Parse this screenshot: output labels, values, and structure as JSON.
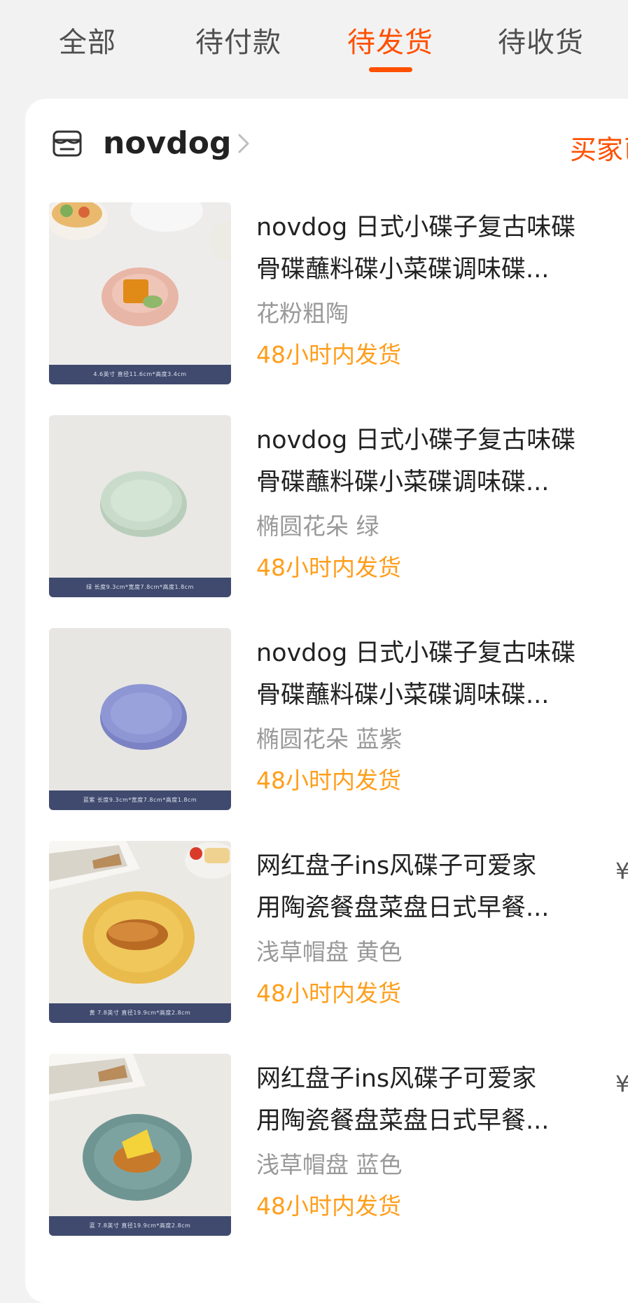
{
  "tabs": [
    {
      "label": "全部",
      "active": false
    },
    {
      "label": "待付款",
      "active": false
    },
    {
      "label": "待发货",
      "active": true
    },
    {
      "label": "待收货",
      "active": false
    }
  ],
  "order": {
    "store_icon": "store-icon",
    "store_name": "novdog",
    "status_text": "买家已",
    "items": [
      {
        "title_line1": "novdog 日式小碟子复古味碟",
        "title_line2": "骨碟蘸料碟小菜碟调味碟...",
        "spec": "花粉粗陶",
        "shipping": "48小时内发货",
        "price": "",
        "thumb_caption": "4.6英寸 直径11.6cm*高度3.4cm",
        "dish_color": "#e8b6a6"
      },
      {
        "title_line1": "novdog 日式小碟子复古味碟",
        "title_line2": "骨碟蘸料碟小菜碟调味碟...",
        "spec": "椭圆花朵 绿",
        "shipping": "48小时内发货",
        "price": "",
        "thumb_caption": "绿 长度9.3cm*宽度7.8cm*高度1.8cm",
        "dish_color": "#c9dccb"
      },
      {
        "title_line1": "novdog 日式小碟子复古味碟",
        "title_line2": "骨碟蘸料碟小菜碟调味碟...",
        "spec": "椭圆花朵 蓝紫",
        "shipping": "48小时内发货",
        "price": "",
        "thumb_caption": "蓝紫 长度9.3cm*宽度7.8cm*高度1.8cm",
        "dish_color": "#8e96d4"
      },
      {
        "title_line1": "网红盘子ins风碟子可爱家",
        "title_line2": "用陶瓷餐盘菜盘日式早餐...",
        "spec": "浅草帽盘 黄色",
        "shipping": "48小时内发货",
        "price": "¥",
        "thumb_caption": "黄 7.8英寸 直径19.9cm*高度2.8cm",
        "dish_color": "#f0c75a"
      },
      {
        "title_line1": "网红盘子ins风碟子可爱家",
        "title_line2": "用陶瓷餐盘菜盘日式早餐...",
        "spec": "浅草帽盘 蓝色",
        "shipping": "48小时内发货",
        "price": "¥",
        "thumb_caption": "蓝 7.8英寸 直径19.9cm*高度2.8cm",
        "dish_color": "#7da3a1"
      }
    ]
  }
}
